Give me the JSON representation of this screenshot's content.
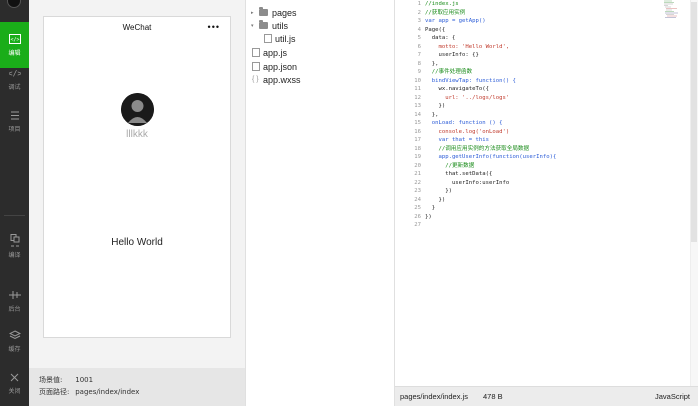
{
  "activity_bar": {
    "items": [
      {
        "label": "编辑",
        "icon": "code-editor-icon",
        "active": true
      },
      {
        "label": "调试",
        "icon": "debug-code-icon"
      },
      {
        "label": "项目",
        "icon": "project-list-icon"
      },
      {
        "label": "编译",
        "icon": "compile-icon"
      },
      {
        "label": "后台",
        "icon": "backend-icon"
      },
      {
        "label": "缓存",
        "icon": "cache-layers-icon"
      },
      {
        "label": "关闭",
        "icon": "close-icon"
      }
    ]
  },
  "simulator": {
    "nav_title": "WeChat",
    "menu_dots": "•••",
    "user_name": "lllkkk",
    "motto": "Hello World",
    "status": {
      "scene_label": "场景值:",
      "scene_value": "1001",
      "path_label": "页面路径:",
      "path_value": "pages/index/index"
    }
  },
  "file_tree": {
    "items": [
      {
        "name": "pages",
        "type": "folder",
        "collapsed": true
      },
      {
        "name": "utils",
        "type": "folder",
        "collapsed": false
      },
      {
        "name": "util.js",
        "type": "file"
      },
      {
        "name": "app.js",
        "type": "file"
      },
      {
        "name": "app.json",
        "type": "file"
      },
      {
        "name": "app.wxss",
        "type": "brace"
      }
    ]
  },
  "editor": {
    "line_numbers": [
      "1",
      "2",
      "3",
      "4",
      "5",
      "6",
      "7",
      "8",
      "9",
      "10",
      "11",
      "12",
      "13",
      "14",
      "15",
      "16",
      "17",
      "18",
      "19",
      "20",
      "21",
      "22",
      "23",
      "24",
      "25",
      "26",
      "27"
    ],
    "lines": [
      "//index.js",
      "//获取应用实例",
      "var app = getApp()",
      "Page({",
      "  data: {",
      "    motto: 'Hello World',",
      "    userInfo: {}",
      "  },",
      "  //事件处理函数",
      "  bindViewTap: function() {",
      "    wx.navigateTo({",
      "      url: '../logs/logs'",
      "    })",
      "  },",
      "  onLoad: function () {",
      "    console.log('onLoad')",
      "    var that = this",
      "    //调用应用实例的方法获取全局数据",
      "    app.getUserInfo(function(userInfo){",
      "      //更新数据",
      "      that.setData({",
      "        userInfo:userInfo",
      "      })",
      "    })",
      "  }",
      "})",
      ""
    ],
    "status": {
      "path": "pages/index/index.js",
      "size": "478 B",
      "language": "JavaScript"
    }
  }
}
